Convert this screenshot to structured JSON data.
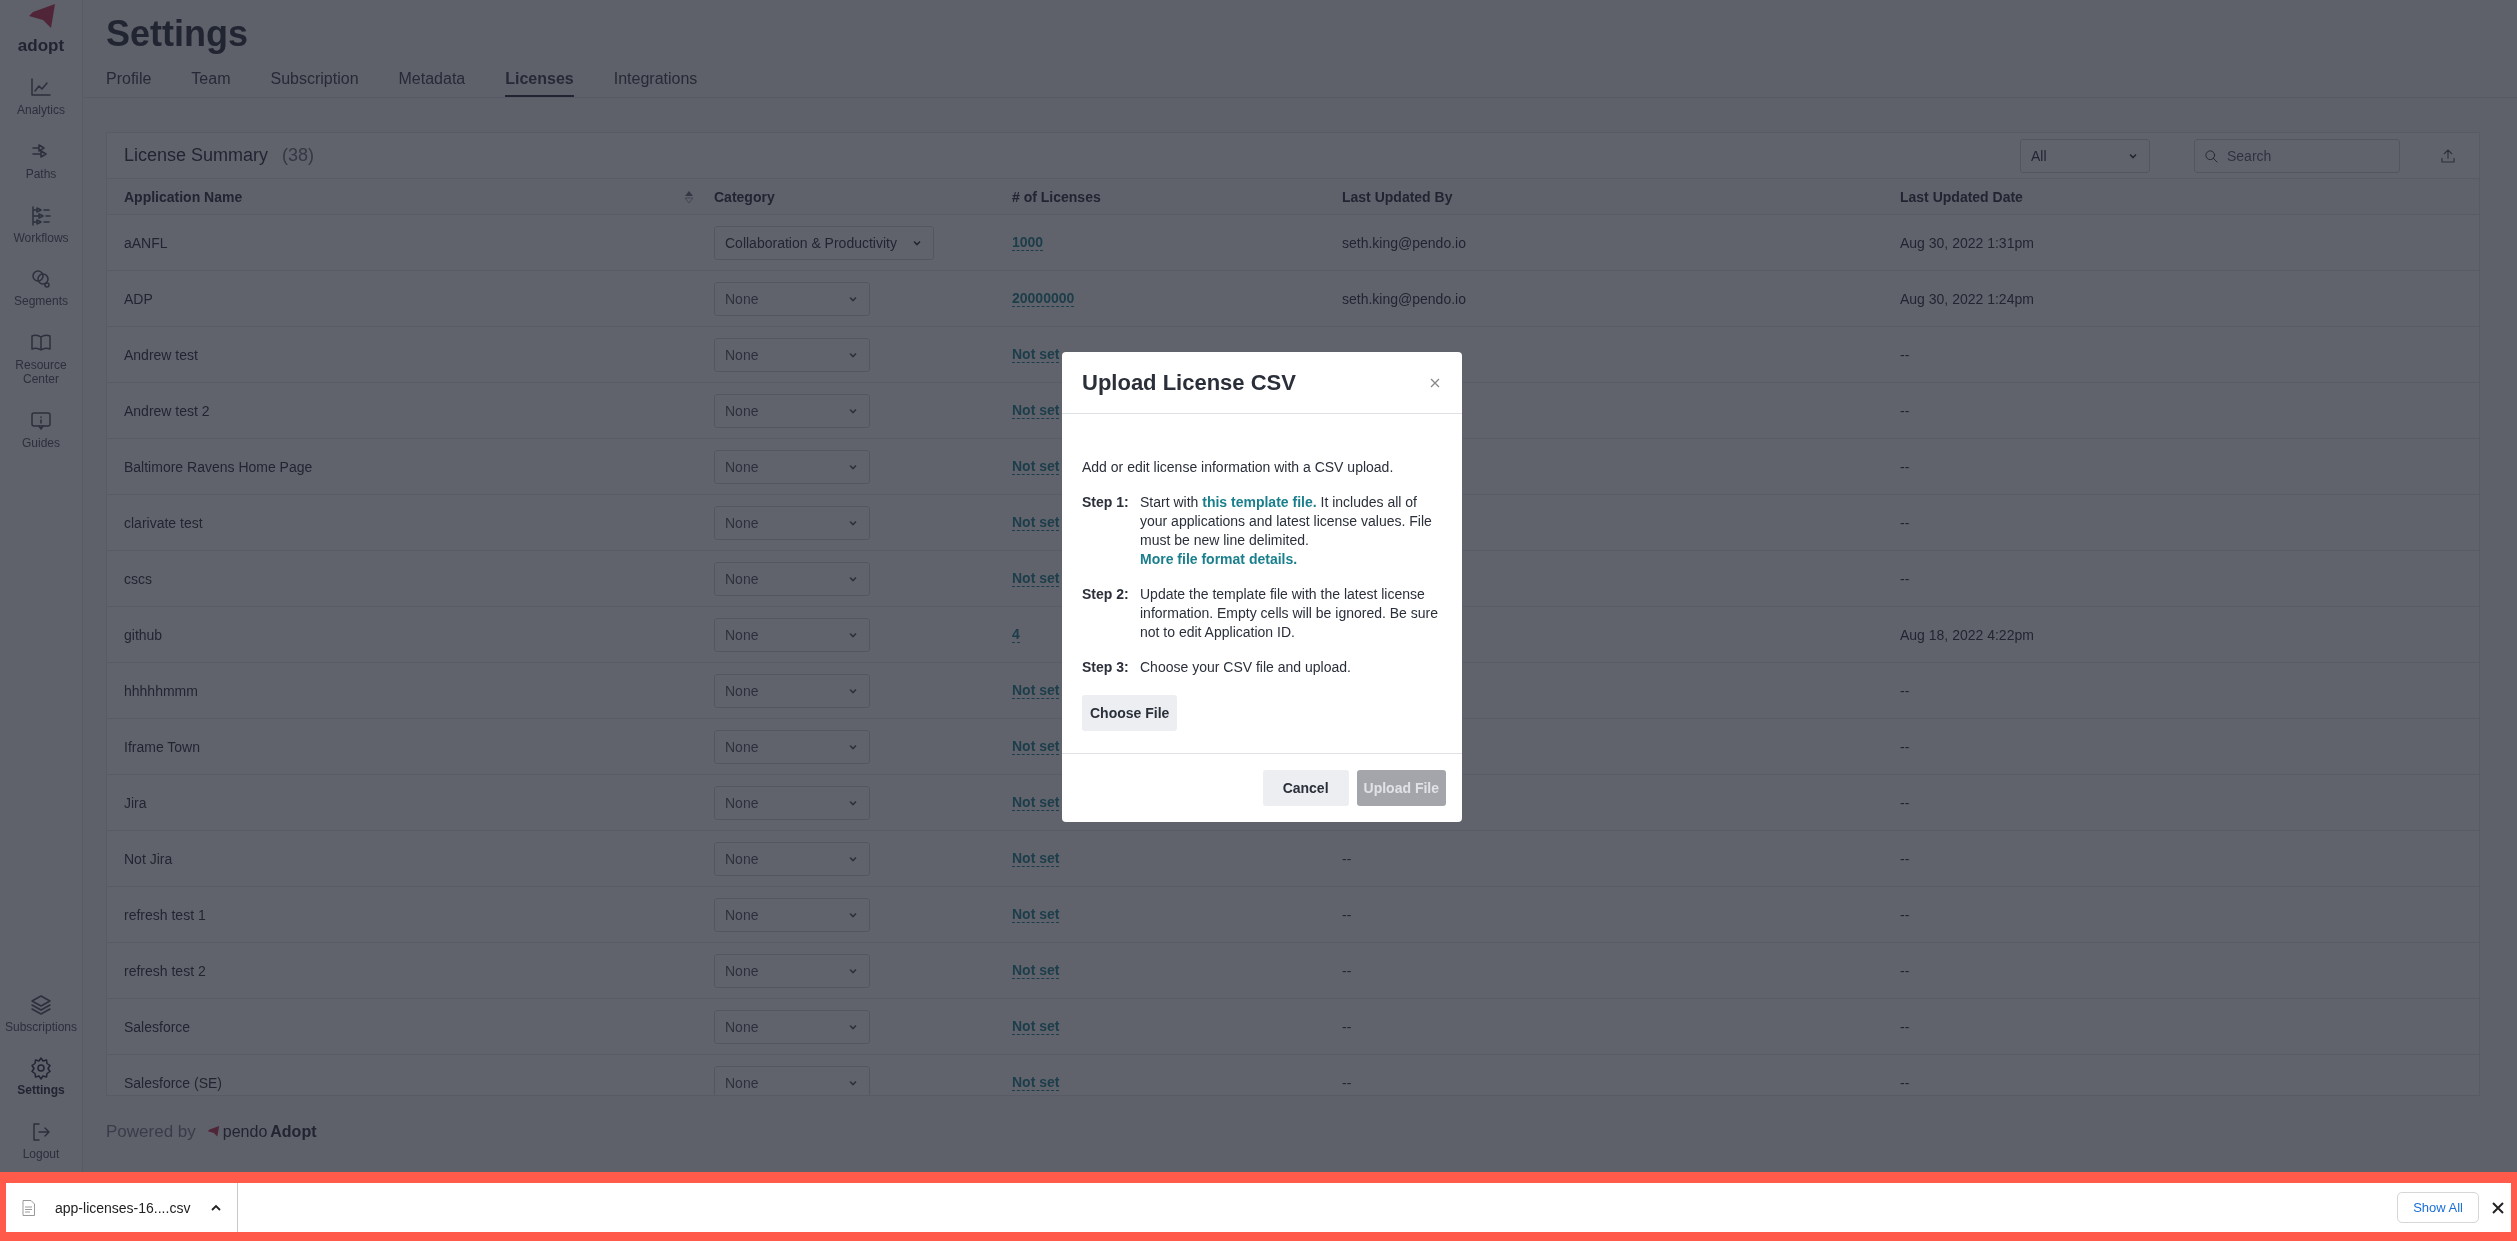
{
  "sidebar": {
    "logo_text": "adopt",
    "items": [
      {
        "label": "Analytics",
        "kind": "analytics",
        "selected": false
      },
      {
        "label": "Paths",
        "kind": "paths",
        "selected": false
      },
      {
        "label": "Workflows",
        "kind": "workflows",
        "selected": false
      },
      {
        "label": "Segments",
        "kind": "segments",
        "selected": false
      },
      {
        "label": "Resource Center",
        "kind": "book",
        "selected": false
      },
      {
        "label": "Guides",
        "kind": "guides",
        "selected": false
      }
    ],
    "bottom_items": [
      {
        "label": "Subscriptions",
        "kind": "layers",
        "selected": false
      },
      {
        "label": "Settings",
        "kind": "settings",
        "selected": true
      },
      {
        "label": "Logout",
        "kind": "logout",
        "selected": false
      }
    ]
  },
  "header": {
    "title": "Settings",
    "tabs": [
      {
        "label": "Profile",
        "selected": false
      },
      {
        "label": "Team",
        "selected": false
      },
      {
        "label": "Subscription",
        "selected": false
      },
      {
        "label": "Metadata",
        "selected": false
      },
      {
        "label": "Licenses",
        "selected": true
      },
      {
        "label": "Integrations",
        "selected": false
      }
    ]
  },
  "license_summary": {
    "title": "License Summary",
    "count": "(38)",
    "filter": {
      "value": "All"
    },
    "search": {
      "placeholder": "Search"
    },
    "table": {
      "columns": [
        {
          "label": "Application Name",
          "sortable": true
        },
        {
          "label": "Category",
          "sortable": false
        },
        {
          "label": "# of Licenses",
          "sortable": false
        },
        {
          "label": "Last Updated By",
          "sortable": false
        },
        {
          "label": "Last Updated Date",
          "sortable": false
        }
      ],
      "rows": [
        {
          "name": "aANFL",
          "category": {
            "value": "Collaboration & Productivity",
            "empty": false
          },
          "licenses": "1000",
          "last_updated_by": "seth.king@pendo.io",
          "last_updated_date": "Aug 30, 2022 1:31pm"
        },
        {
          "name": "ADP",
          "category": {
            "value": "None",
            "empty": true
          },
          "licenses": "20000000",
          "last_updated_by": "seth.king@pendo.io",
          "last_updated_date": "Aug 30, 2022 1:24pm"
        },
        {
          "name": "Andrew test",
          "category": {
            "value": "None",
            "empty": true
          },
          "licenses": "Not set",
          "last_updated_date": "--"
        },
        {
          "name": "Andrew test 2",
          "category": {
            "value": "None",
            "empty": true
          },
          "licenses": "Not set",
          "last_updated_date": "--"
        },
        {
          "name": "Baltimore Ravens Home Page",
          "category": {
            "value": "None",
            "empty": true
          },
          "licenses": "Not set",
          "last_updated_date": "--"
        },
        {
          "name": "clarivate test",
          "category": {
            "value": "None",
            "empty": true
          },
          "licenses": "Not set",
          "last_updated_date": "--"
        },
        {
          "name": "cscs",
          "category": {
            "value": "None",
            "empty": true
          },
          "licenses": "Not set",
          "last_updated_date": "--"
        },
        {
          "name": "github",
          "category": {
            "value": "None",
            "empty": true
          },
          "licenses": "4",
          "last_updated_date": "Aug 18, 2022 4:22pm"
        },
        {
          "name": "hhhhhmmm",
          "category": {
            "value": "None",
            "empty": true
          },
          "licenses": "Not set",
          "last_updated_date": "--"
        },
        {
          "name": "Iframe Town",
          "category": {
            "value": "None",
            "empty": true
          },
          "licenses": "Not set",
          "last_updated_date": "--"
        },
        {
          "name": "Jira",
          "category": {
            "value": "None",
            "empty": true
          },
          "licenses": "Not set",
          "last_updated_date": "--"
        },
        {
          "name": "Not Jira",
          "category": {
            "value": "None",
            "empty": true
          },
          "licenses": "Not set",
          "last_updated_by": "--",
          "last_updated_date": "--"
        },
        {
          "name": "refresh test 1",
          "category": {
            "value": "None",
            "empty": true
          },
          "licenses": "Not set",
          "last_updated_by": "--",
          "last_updated_date": "--"
        },
        {
          "name": "refresh test 2",
          "category": {
            "value": "None",
            "empty": true
          },
          "licenses": "Not set",
          "last_updated_by": "--",
          "last_updated_date": "--"
        },
        {
          "name": "Salesforce",
          "category": {
            "value": "None",
            "empty": true
          },
          "licenses": "Not set",
          "last_updated_by": "--",
          "last_updated_date": "--"
        },
        {
          "name": "Salesforce (SE)",
          "category": {
            "value": "None",
            "empty": true
          },
          "licenses": "Not set",
          "last_updated_by": "--",
          "last_updated_date": "--"
        }
      ]
    }
  },
  "footer": {
    "powered_by": "Powered by",
    "brand": "pendo",
    "product": "Adopt"
  },
  "modal": {
    "title": "Upload License CSV",
    "intro": "Add or edit license information with a CSV upload.",
    "steps": [
      {
        "label": "Step 1:",
        "parts": [
          {
            "kind": "text",
            "text": "Start with "
          },
          {
            "kind": "link",
            "text": "this template file."
          },
          {
            "kind": "text",
            "text": " It includes all of your applications and latest license values. File must be new line delimited. "
          },
          {
            "kind": "link",
            "text": "More file format details."
          }
        ]
      },
      {
        "label": "Step 2:",
        "parts": [
          {
            "kind": "text",
            "text": "Update the template file with the latest license information. Empty cells will be ignored. Be sure not to edit Application ID."
          }
        ]
      },
      {
        "label": "Step 3:",
        "parts": [
          {
            "kind": "text",
            "text": "Choose your CSV file and upload."
          }
        ]
      }
    ],
    "choose_button": "Choose File",
    "buttons": [
      {
        "label": "Cancel",
        "disabled": false
      },
      {
        "label": "Upload File",
        "disabled": true
      }
    ]
  },
  "download_bar": {
    "file_name": "app-licenses-16....csv",
    "show_all": "Show All"
  }
}
